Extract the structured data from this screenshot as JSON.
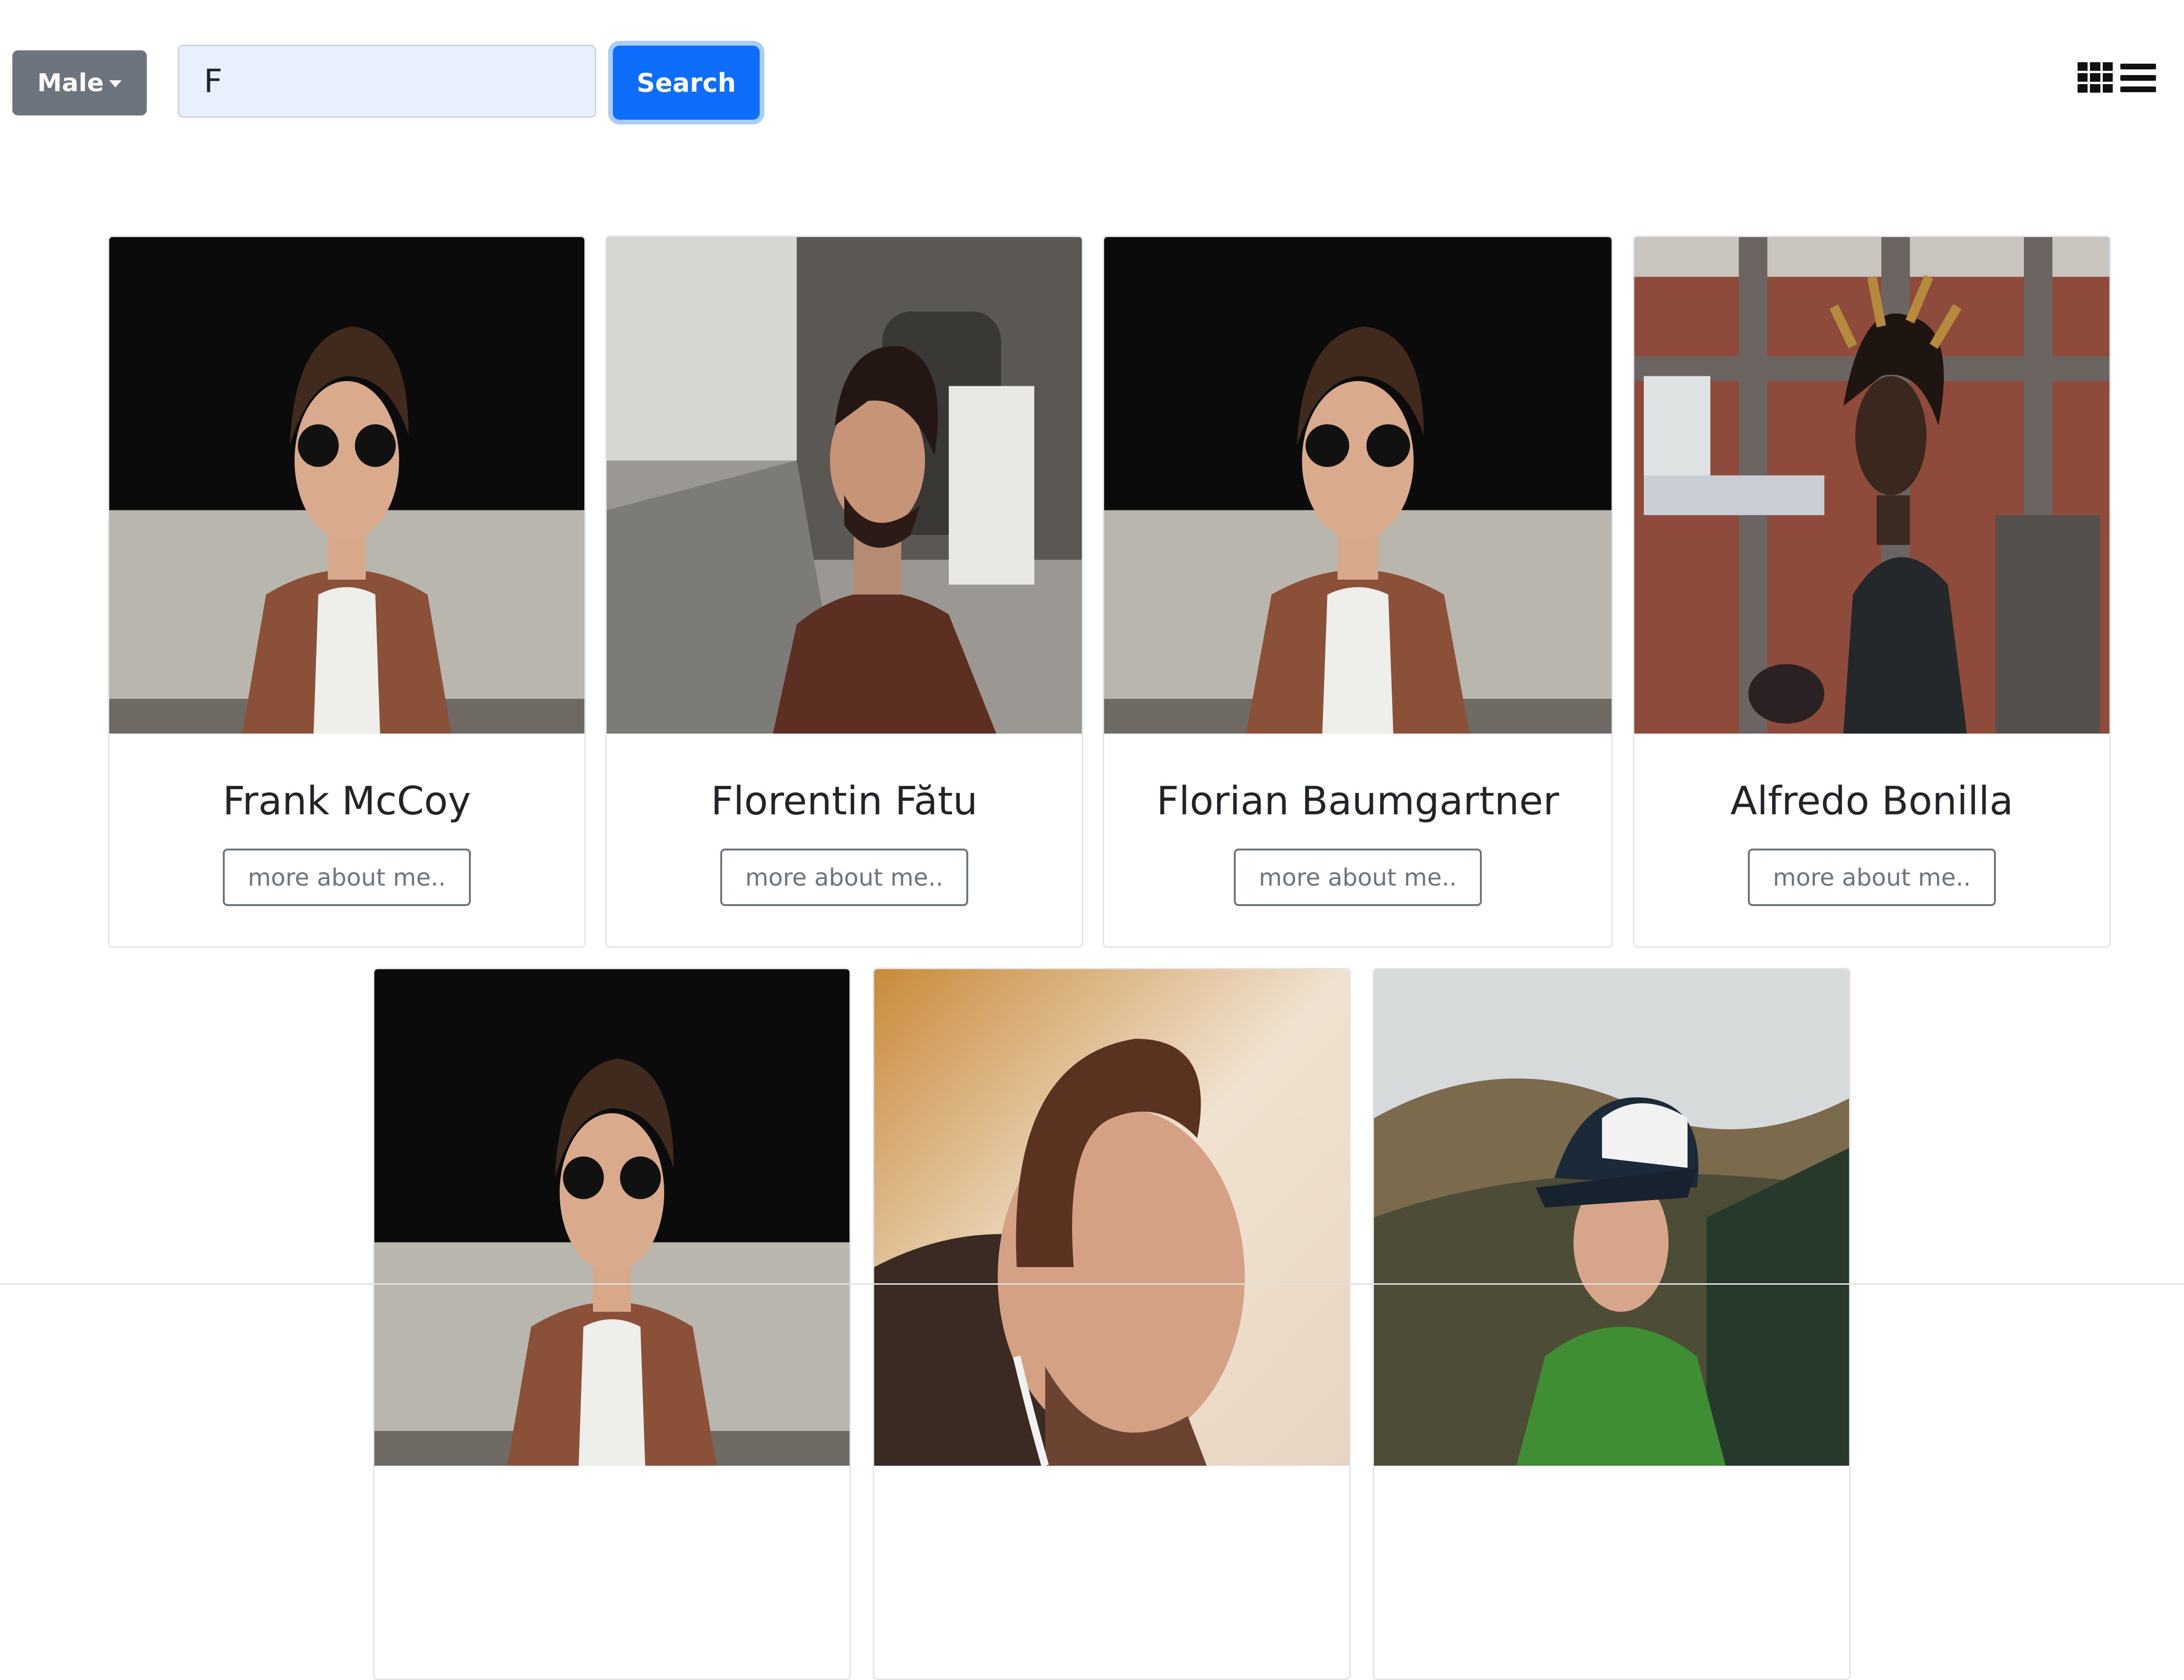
{
  "toolbar": {
    "gender_filter": {
      "selected": "Male"
    },
    "search": {
      "value": "F",
      "button_label": "Search"
    },
    "view_icons": [
      "grid-view-icon",
      "list-view-icon"
    ]
  },
  "people": [
    {
      "name": "Frank McCoy",
      "button": "more about me..",
      "photo": "man-sunglasses-brown-jacket"
    },
    {
      "name": "Florentin Fătu",
      "button": "more about me..",
      "photo": "man-profile-leather-jacket-street"
    },
    {
      "name": "Florian Baumgartner",
      "button": "more about me..",
      "photo": "man-sunglasses-brown-jacket"
    },
    {
      "name": "Alfredo Bonilla",
      "button": "more about me..",
      "photo": "man-dreadlocks-brick-building"
    },
    {
      "name": "",
      "button": "",
      "photo": "man-sunglasses-brown-jacket"
    },
    {
      "name": "",
      "button": "",
      "photo": "man-earphones-sunset"
    },
    {
      "name": "",
      "button": "",
      "photo": "man-cap-mountains"
    }
  ],
  "colors": {
    "primary": "#0d6efd",
    "secondary": "#6c757d",
    "input_bg": "#e8f0fe"
  }
}
